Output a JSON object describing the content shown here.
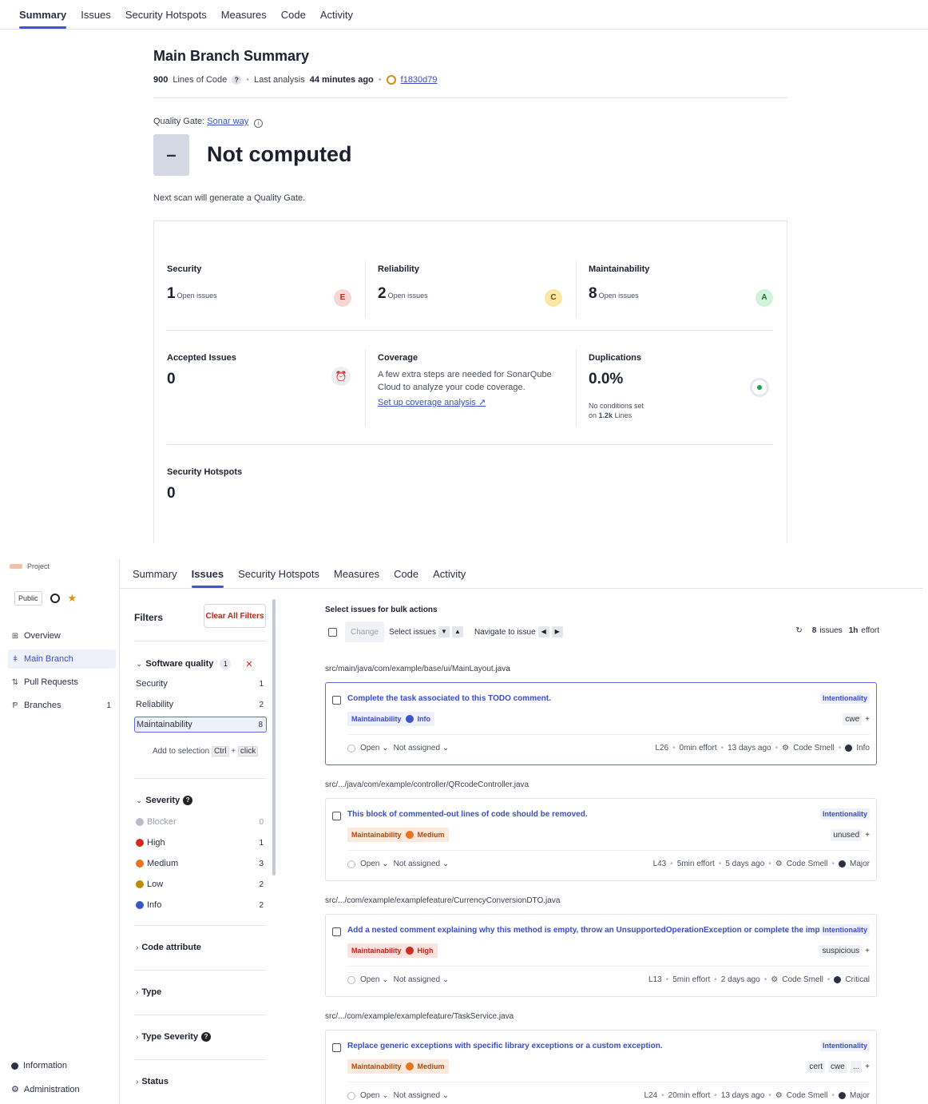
{
  "summary_panel": {
    "tabs": [
      "Summary",
      "Issues",
      "Security Hotspots",
      "Measures",
      "Code",
      "Activity"
    ],
    "title": "Main Branch Summary",
    "meta": {
      "loc": "900",
      "loc_label": "Lines of Code",
      "analysis_label": "Last analysis",
      "analysis_time": "44 minutes ago",
      "commit": "f1830d79"
    },
    "quality_gate": {
      "label": "Quality Gate:",
      "name": "Sonar way",
      "box_symbol": "–",
      "status": "Not computed",
      "next_scan": "Next scan will generate a Quality Gate."
    },
    "cards": {
      "security": {
        "title": "Security",
        "value": "1",
        "unit": "Open issues",
        "grade": "E",
        "grade_color": "#f7d6d4",
        "grade_text": "#c0261b"
      },
      "reliability": {
        "title": "Reliability",
        "value": "2",
        "unit": "Open issues",
        "grade": "C",
        "grade_color": "#fbe6a4",
        "grade_text": "#6b5104"
      },
      "maintainability": {
        "title": "Maintainability",
        "value": "8",
        "unit": "Open issues",
        "grade": "A",
        "grade_color": "#d1f2dc",
        "grade_text": "#1e6b34"
      },
      "accepted": {
        "title": "Accepted Issues",
        "value": "0"
      },
      "coverage": {
        "title": "Coverage",
        "text": "A few extra steps are needed for SonarQube Cloud to analyze your code coverage.",
        "link": "Set up coverage analysis"
      },
      "duplications": {
        "title": "Duplications",
        "value": "0.0%",
        "note_1": "No conditions set",
        "note_2_prefix": "on",
        "note_2_value": "1.2k",
        "note_2_suffix": "Lines"
      },
      "hotspots": {
        "title": "Security Hotspots",
        "value": "0"
      }
    }
  },
  "issues_panel": {
    "sidebar": {
      "project": "Project",
      "public": "Public",
      "nav": [
        {
          "label": "Overview",
          "icon": "grid-icon"
        },
        {
          "label": "Main Branch",
          "icon": "branch-icon"
        },
        {
          "label": "Pull Requests",
          "icon": "pull-request-icon"
        },
        {
          "label": "Branches",
          "icon": "branches-icon",
          "count": "1"
        }
      ],
      "info": "Information",
      "admin": "Administration"
    },
    "tabs": [
      "Summary",
      "Issues",
      "Security Hotspots",
      "Measures",
      "Code",
      "Activity"
    ],
    "filters": {
      "title": "Filters",
      "clear": "Clear All Filters",
      "software_quality": {
        "title": "Software quality",
        "badge": "1",
        "rows": [
          {
            "label": "Security",
            "count": "1"
          },
          {
            "label": "Reliability",
            "count": "2"
          },
          {
            "label": "Maintainability",
            "count": "8"
          }
        ]
      },
      "add_selection": "Add to selection",
      "kbd_ctrl": "Ctrl",
      "kbd_click": "click",
      "severity": {
        "title": "Severity",
        "rows": [
          {
            "label": "Blocker",
            "count": "0",
            "color": "#b9bdc7"
          },
          {
            "label": "High",
            "count": "1",
            "color": "#d02b1d"
          },
          {
            "label": "Medium",
            "count": "3",
            "color": "#e8741f"
          },
          {
            "label": "Low",
            "count": "2",
            "color": "#c08a08"
          },
          {
            "label": "Info",
            "count": "2",
            "color": "#3a56c8"
          }
        ]
      },
      "collapsed": [
        "Code attribute",
        "Type",
        "Type Severity",
        "Status"
      ]
    },
    "bulk": {
      "label": "Select issues for bulk actions",
      "change": "Change",
      "select_issues": "Select issues",
      "navigate": "Navigate to issue",
      "issues_count": "8",
      "issues_word": "issues",
      "effort": "1h",
      "effort_word": "effort"
    },
    "issues": [
      {
        "path": "src/main/java/com/example/base/ui/MainLayout.java",
        "title": "Complete the task associated to this TODO comment.",
        "tag_intent": "Intentionality",
        "quality": "Maintainability",
        "severity": "Info",
        "sev_class": "info",
        "tags": [
          "cwe"
        ],
        "status": "Open",
        "assignee": "Not assigned",
        "line": "L26",
        "effort": "0min effort",
        "age": "13 days ago",
        "type": "Code Smell",
        "legacy_sev": "Info"
      },
      {
        "path": "src/.../java/com/example/controller/QRcodeController.java",
        "title": "This block of commented-out lines of code should be removed.",
        "tag_intent": "Intentionality",
        "quality": "Maintainability",
        "severity": "Medium",
        "sev_class": "medium",
        "tags": [
          "unused"
        ],
        "status": "Open",
        "assignee": "Not assigned",
        "line": "L43",
        "effort": "5min effort",
        "age": "5 days ago",
        "type": "Code Smell",
        "legacy_sev": "Major"
      },
      {
        "path": "src/.../com/example/examplefeature/CurrencyConversionDTO.java",
        "title": "Add a nested comment explaining why this method is empty, throw an UnsupportedOperationException or complete the implementation.",
        "tag_intent": "Intentionality",
        "quality": "Maintainability",
        "severity": "High",
        "sev_class": "high",
        "tags": [
          "suspicious"
        ],
        "status": "Open",
        "assignee": "Not assigned",
        "line": "L13",
        "effort": "5min effort",
        "age": "2 days ago",
        "type": "Code Smell",
        "legacy_sev": "Critical"
      },
      {
        "path": "src/.../com/example/examplefeature/TaskService.java",
        "title": "Replace generic exceptions with specific library exceptions or a custom exception.",
        "tag_intent": "Intentionality",
        "quality": "Maintainability",
        "severity": "Medium",
        "sev_class": "medium",
        "tags": [
          "cert",
          "cwe",
          "..."
        ],
        "status": "Open",
        "assignee": "Not assigned",
        "line": "L24",
        "effort": "20min effort",
        "age": "13 days ago",
        "type": "Code Smell",
        "legacy_sev": "Major"
      }
    ]
  }
}
